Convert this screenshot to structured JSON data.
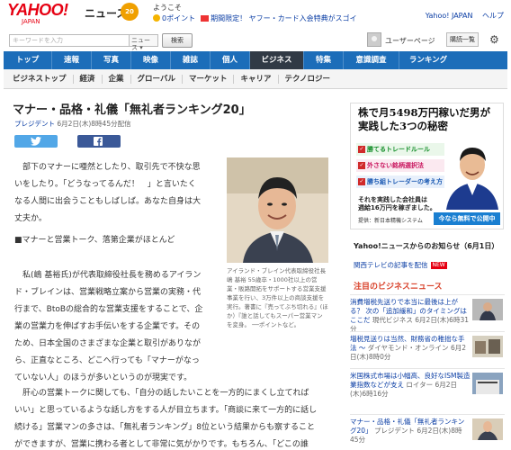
{
  "header": {
    "logo": "YAHOO!",
    "logo_sub": "JAPAN",
    "service": "ニュース",
    "badge": "20",
    "welcome": "ようこそ",
    "points": "0ポイント",
    "promo": "期間限定！ ヤフー・カード入会特典がスゴイ",
    "links": [
      "Yahoo! JAPAN",
      "ヘルプ"
    ]
  },
  "search": {
    "placeholder": "キーワードを入力",
    "scope": "ニュース",
    "button": "検索"
  },
  "user": {
    "page": "ユーザーページ",
    "new_button": "購読一覧"
  },
  "nav": {
    "tabs": [
      {
        "label": "トップ"
      },
      {
        "label": "速報"
      },
      {
        "label": "写真"
      },
      {
        "label": "映像"
      },
      {
        "label": "雑誌"
      },
      {
        "label": "個人"
      },
      {
        "label": "ビジネス"
      },
      {
        "label": "特集"
      },
      {
        "label": "意識調査"
      },
      {
        "label": "ランキング"
      }
    ],
    "active": "ビジネス"
  },
  "subnav": {
    "items": [
      "ビジネストップ",
      "経済",
      "企業",
      "グローバル",
      "マーケット",
      "キャリア",
      "テクノロジー"
    ]
  },
  "article": {
    "title": "マナー・品格・礼儀「無礼者ランキング20」",
    "source": "プレジデント",
    "date": "6月2日(木)8時45分配信",
    "paragraphs": [
      [
        "部下のマナーに唖然としたり、取引先で不快な思",
        "いをしたり。「どうなってるんだ！　」と言いたく",
        "なる人間に出会うこともしばしば。あなた自身は大",
        "丈夫か。"
      ],
      [
        "■マナーと営業トーク、落第企業がほとんど"
      ],
      [
        "私(嶋 基裕氏)が代表取締役社長を務めるアイラン",
        "ド・ブレインは、営業戦略立案から営業の実務・代",
        "行まで、BtoBの総合的な営業支援をすることで、企",
        "業の営業力を伸ばすお手伝いをする企業です。その",
        "ため、日本全国のさまざまな企業と取引がありなが",
        "ら、正直なところ、どこへ行っても「マナーがなっ",
        "ていない人」のほうが多いというのが現実です。"
      ],
      [
        "肝心の営業トークに関しても、「自分の話したいことを一方的にまくし立てれば",
        "いい」と思っているような話し方をする人が目立ちます。「商談に来て一方的に話し",
        "続ける」営業マンの多さは、「無礼者ランキング」8位という結果からも察すること",
        "ができますが、営業に携わる者として非常に気がかりです。もちろん、「どこの誰"
      ]
    ],
    "caption": "アイランド・ブレイン代表取締役社長　嶋 基裕 55歳卒・1000社以上の営業・販路開拓をサポートする営業支援事業を行い、3万件以上の商談支援を実行。著書に『売ってぶち切れる』(ほか）『誰と話してもスーパー営業マンを変身。 ──ポイントなど。"
  },
  "ad": {
    "headline": [
      "株で月5498万円稼いだ男が",
      "実践した3つの秘密"
    ],
    "items": [
      "勝てるトレードルール",
      "外さない銘柄選択法",
      "勝ち組トレーダーの考え方"
    ],
    "body": [
      "それを実践した会社員は",
      "週給16万円を稼ぎました。"
    ],
    "provider": "提供：新日本精機システム",
    "cta": "今なら無料で公開中"
  },
  "notices": {
    "title": "Yahoo!ニュースからのお知らせ（6月1日）",
    "link": "関西テレビの記事を配信",
    "new_label": "NEW"
  },
  "business_news": {
    "title": "注目のビジネスニュース",
    "items": [
      {
        "headline": "消費増税先送りで本当に最後は上がる？ 次の「追加緩和」のタイミングはここだ",
        "source": "現代ビジネス",
        "time": "6月2日(木)6時31分"
      },
      {
        "headline": "増税見送りは当然、財務省の稚拙な手法 ～",
        "source": "ダイヤモンド・オンライン",
        "time": "6月2日(木)8時0分"
      },
      {
        "headline": "米国株式市場は小幅高、良好なISM製造業指数などが支え",
        "source": "ロイター",
        "time": "6月2日(木)6時16分"
      },
      {
        "headline": "マナー・品格・礼儀「無礼者ランキング20」",
        "source": "プレジデント",
        "time": "6月2日(木)8時45分"
      }
    ]
  },
  "colors": {
    "nav_blue": "#1c6db9",
    "nav_active": "#313a45",
    "link_blue": "#0a3da4",
    "accent_red": "#d9432c",
    "yahoo_red": "#e60012"
  }
}
